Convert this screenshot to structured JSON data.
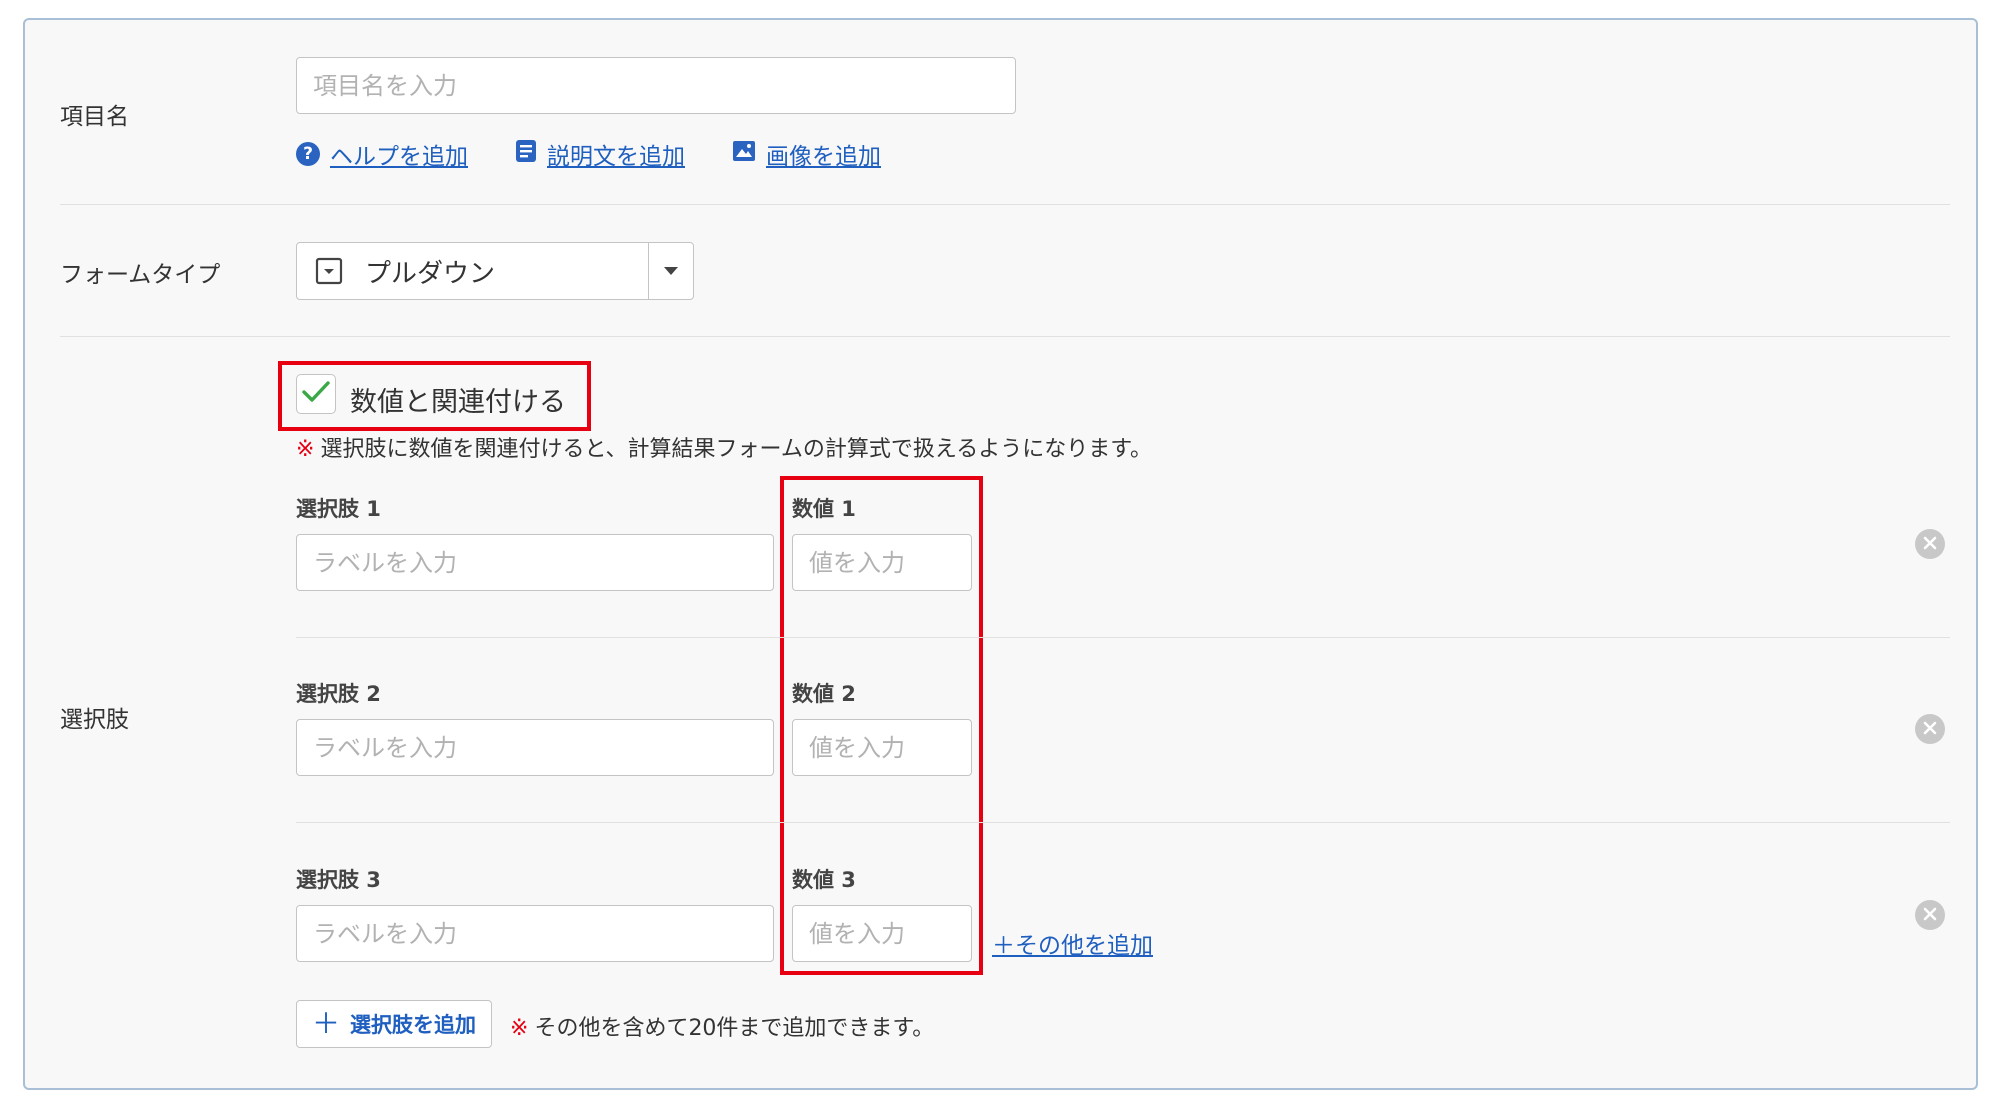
{
  "item_name": {
    "label": "項目名",
    "placeholder": "項目名を入力",
    "links": {
      "help": "ヘルプを追加",
      "description": "説明文を追加",
      "image": "画像を追加"
    }
  },
  "form_type": {
    "label": "フォームタイプ",
    "selected": "プルダウン"
  },
  "choices": {
    "label": "選択肢",
    "associate_checkbox": {
      "label": "数値と関連付ける",
      "checked": true
    },
    "associate_note_mark": "※",
    "associate_note": "選択肢に数値を関連付けると、計算結果フォームの計算式で扱えるようになります。",
    "items": [
      {
        "label": "選択肢 1",
        "label_placeholder": "ラベルを入力",
        "value_label": "数値 1",
        "value_placeholder": "値を入力"
      },
      {
        "label": "選択肢 2",
        "label_placeholder": "ラベルを入力",
        "value_label": "数値 2",
        "value_placeholder": "値を入力"
      },
      {
        "label": "選択肢 3",
        "label_placeholder": "ラベルを入力",
        "value_label": "数値 3",
        "value_placeholder": "値を入力"
      }
    ],
    "add_other_link": "＋その他を追加",
    "add_choice_button": "選択肢を追加",
    "limit_note_mark": "※",
    "limit_note": "その他を含めて20件まで追加できます。"
  },
  "colors": {
    "accent_link": "#1f5fbf",
    "highlight_frame": "#e60012",
    "check": "#3aa845",
    "panel_background": "#f8f8f8"
  },
  "icons": {
    "help": "question-circle-icon",
    "description": "document-icon",
    "image": "image-icon",
    "select": "dropdown-select-icon",
    "caret": "caret-down-icon",
    "check": "check-icon",
    "remove": "close-circle-icon",
    "add": "plus-icon"
  }
}
